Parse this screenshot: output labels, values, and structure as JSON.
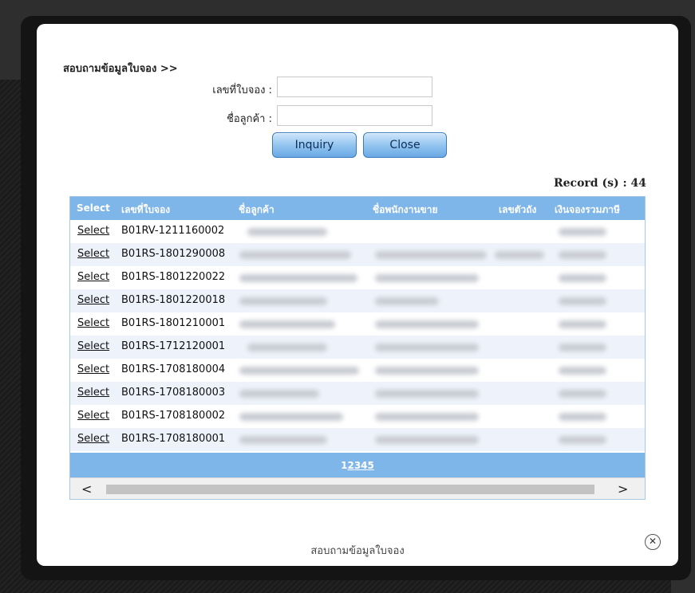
{
  "dialog": {
    "heading": "สอบถามข้อมูลใบจอง >>",
    "footer_title": "สอบถามข้อมูลใบจอง",
    "close_glyph": "✕"
  },
  "form": {
    "booking_no_label": "เลขที่ใบจอง :",
    "booking_no_value": "",
    "customer_label": "ชื่อลูกค้า :",
    "customer_value": ""
  },
  "buttons": {
    "inquiry": "Inquiry",
    "close": "Close"
  },
  "record_count": "Record (s) : 44",
  "grid": {
    "columns": [
      "Select",
      "เลขที่ใบจอง",
      "ชื่อลูกค้า",
      "ชื่อพนักงานขาย",
      "เลขตัวถัง",
      "เงินจองรวมภาษี"
    ],
    "rows": [
      {
        "select": "Select",
        "booking_no": "B01RV-1211160002"
      },
      {
        "select": "Select",
        "booking_no": "B01RS-1801290008"
      },
      {
        "select": "Select",
        "booking_no": "B01RS-1801220022"
      },
      {
        "select": "Select",
        "booking_no": "B01RS-1801220018"
      },
      {
        "select": "Select",
        "booking_no": "B01RS-1801210001"
      },
      {
        "select": "Select",
        "booking_no": "B01RS-1712120001"
      },
      {
        "select": "Select",
        "booking_no": "B01RS-1708180004"
      },
      {
        "select": "Select",
        "booking_no": "B01RS-1708180003"
      },
      {
        "select": "Select",
        "booking_no": "B01RS-1708180002"
      },
      {
        "select": "Select",
        "booking_no": "B01RS-1708180001"
      }
    ],
    "pages": [
      "1",
      "2",
      "3",
      "4",
      "5"
    ],
    "current_page": "1",
    "scroll_left_icon": "<",
    "scroll_right_icon": ">"
  }
}
